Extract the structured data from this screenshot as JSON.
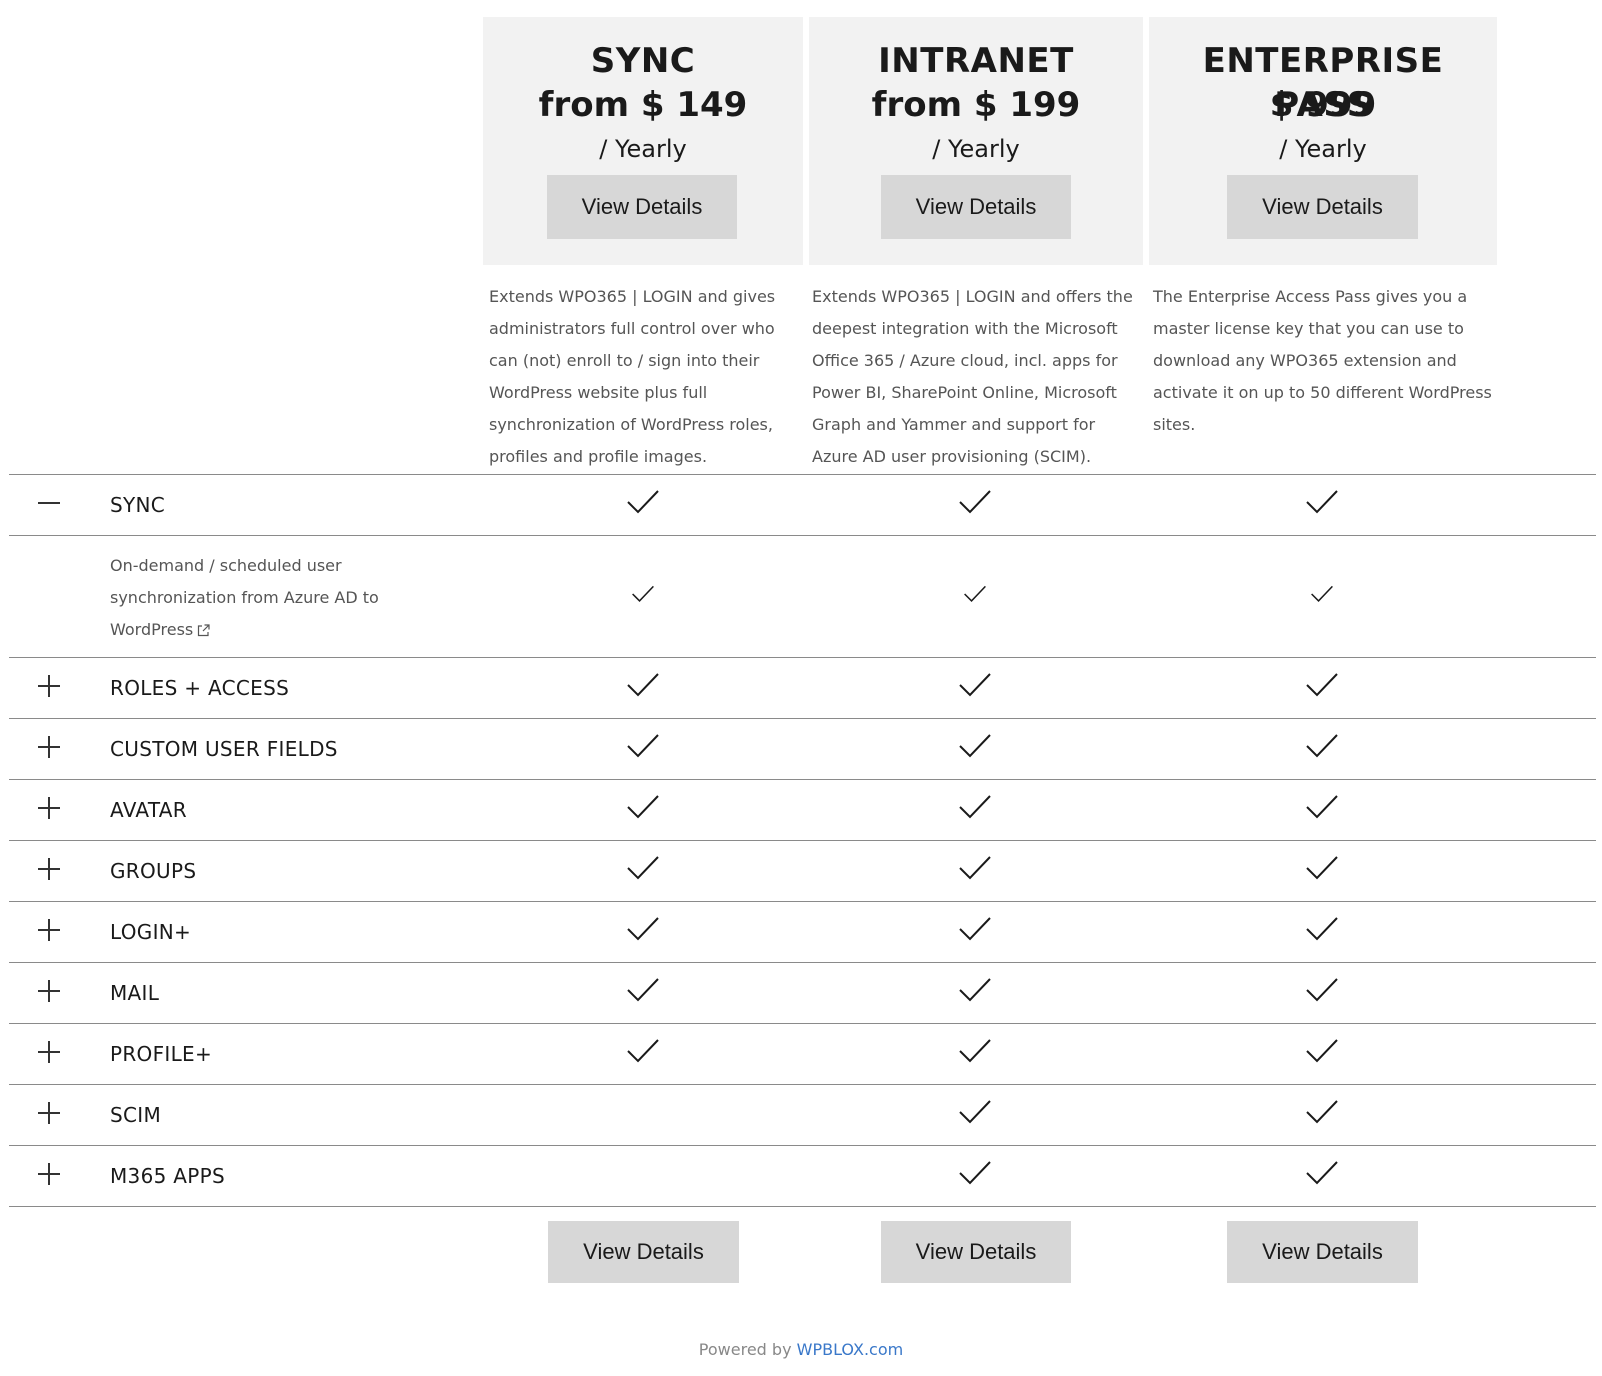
{
  "plans": [
    {
      "name": "SYNC",
      "price": "from $ 149",
      "period": "/ Yearly",
      "button": "View Details",
      "description": "Extends WPO365 | LOGIN and gives administrators full control over who can (not) enroll to / sign into their WordPress website plus full synchronization of WordPress roles, profiles and profile images."
    },
    {
      "name": "INTRANET",
      "price": "from $ 199",
      "period": "/ Yearly",
      "button": "View Details",
      "description": "Extends WPO365 | LOGIN and offers the deepest integration with the Microsoft Office 365 / Azure cloud, incl. apps for Power BI, SharePoint Online, Microsoft Graph and Yammer and support for Azure AD user provisioning (SCIM)."
    },
    {
      "name": "ENTERPRISE PASS",
      "price": "$ 999",
      "period": "/ Yearly",
      "button": "View Details",
      "description": "The Enterprise Access Pass gives you a master license key that you can use to download any WPO365 extension and activate it on up to 50 different WordPress sites."
    }
  ],
  "features": [
    {
      "label": "SYNC",
      "expanded": true,
      "checks": [
        true,
        true,
        true
      ],
      "sub": {
        "text": "On-demand / scheduled user synchronization from Azure AD to WordPress",
        "checks": [
          true,
          true,
          true
        ]
      }
    },
    {
      "label": "ROLES + ACCESS",
      "expanded": false,
      "checks": [
        true,
        true,
        true
      ]
    },
    {
      "label": "CUSTOM USER FIELDS",
      "expanded": false,
      "checks": [
        true,
        true,
        true
      ]
    },
    {
      "label": "AVATAR",
      "expanded": false,
      "checks": [
        true,
        true,
        true
      ]
    },
    {
      "label": "GROUPS",
      "expanded": false,
      "checks": [
        true,
        true,
        true
      ]
    },
    {
      "label": "LOGIN+",
      "expanded": false,
      "checks": [
        true,
        true,
        true
      ]
    },
    {
      "label": "MAIL",
      "expanded": false,
      "checks": [
        true,
        true,
        true
      ]
    },
    {
      "label": "PROFILE+",
      "expanded": false,
      "checks": [
        true,
        true,
        true
      ]
    },
    {
      "label": "SCIM",
      "expanded": false,
      "checks": [
        false,
        true,
        true
      ]
    },
    {
      "label": "M365 APPS",
      "expanded": false,
      "checks": [
        false,
        true,
        true
      ]
    }
  ],
  "bottom_buttons": [
    "View Details",
    "View Details",
    "View Details"
  ],
  "footer": {
    "prefix": "Powered by",
    "link": "WPBLOX.com"
  },
  "colors": {
    "card_bg": "#f2f2f2",
    "button_bg": "#d7d7d7",
    "link": "#3a78c9"
  },
  "icons": {
    "collapse": "minus-icon",
    "expand": "plus-icon",
    "check": "check-icon",
    "external": "external-link-icon"
  }
}
